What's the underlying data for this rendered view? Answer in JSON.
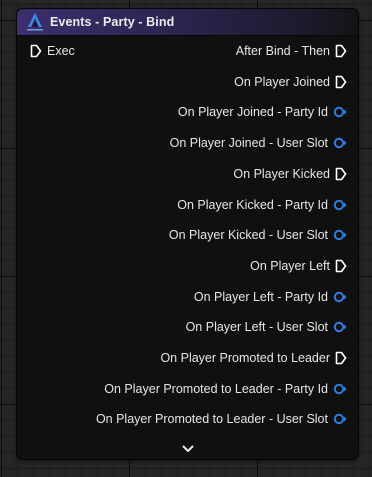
{
  "node": {
    "title": "Events - Party - Bind",
    "logo": "unreal-logo-icon",
    "header_color": "#3c2f6e",
    "exec_pin_color": "#ffffff",
    "data_pin_color": "#2f7fe0"
  },
  "inputs": [
    {
      "label": "Exec",
      "type": "exec"
    }
  ],
  "outputs": [
    {
      "label": "After Bind - Then",
      "type": "exec"
    },
    {
      "label": "On Player Joined",
      "type": "exec"
    },
    {
      "label": "On Player Joined - Party Id",
      "type": "data"
    },
    {
      "label": "On Player Joined - User Slot",
      "type": "data"
    },
    {
      "label": "On Player Kicked",
      "type": "exec"
    },
    {
      "label": "On Player Kicked - Party Id",
      "type": "data"
    },
    {
      "label": "On Player Kicked - User Slot",
      "type": "data"
    },
    {
      "label": "On Player Left",
      "type": "exec"
    },
    {
      "label": "On Player Left - Party Id",
      "type": "data"
    },
    {
      "label": "On Player Left - User Slot",
      "type": "data"
    },
    {
      "label": "On Player Promoted to Leader",
      "type": "exec"
    },
    {
      "label": "On Player Promoted to Leader - Party Id",
      "type": "data"
    },
    {
      "label": "On Player Promoted to Leader - User Slot",
      "type": "data"
    }
  ],
  "expand_icon": "chevron-down-icon"
}
